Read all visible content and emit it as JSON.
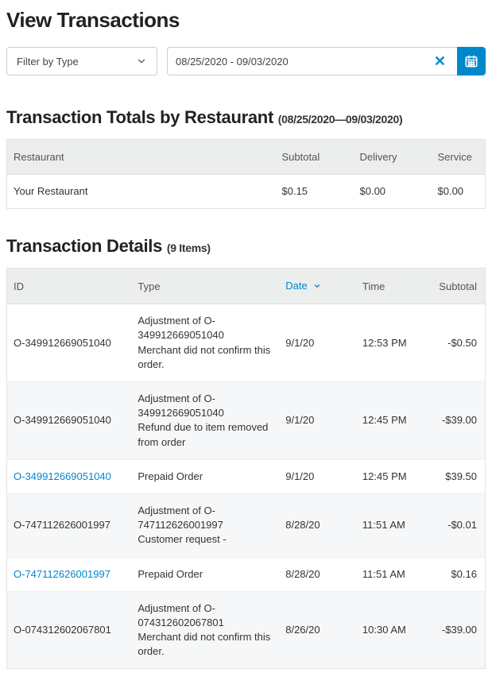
{
  "page_title": "View Transactions",
  "filter_type_label": "Filter by Type",
  "date_range_value": "08/25/2020 - 09/03/2020",
  "totals": {
    "heading": "Transaction Totals by Restaurant",
    "range": "(08/25/2020—09/03/2020)",
    "columns": {
      "restaurant": "Restaurant",
      "subtotal": "Subtotal",
      "delivery": "Delivery",
      "service": "Service"
    },
    "rows": [
      {
        "restaurant": "Your Restaurant",
        "subtotal": "$0.15",
        "delivery": "$0.00",
        "service": "$0.00"
      }
    ]
  },
  "details": {
    "heading": "Transaction Details",
    "count_label": "(9 Items)",
    "columns": {
      "id": "ID",
      "type": "Type",
      "date": "Date",
      "time": "Time",
      "subtotal": "Subtotal"
    },
    "rows": [
      {
        "id": "O-349912669051040",
        "link": false,
        "type": "Adjustment of O-349912669051040\nMerchant did not confirm this order.",
        "date": "9/1/20",
        "time": "12:53 PM",
        "subtotal": "-$0.50"
      },
      {
        "id": "O-349912669051040",
        "link": false,
        "type": "Adjustment of O-349912669051040\nRefund due to item removed from order",
        "date": "9/1/20",
        "time": "12:45 PM",
        "subtotal": "-$39.00"
      },
      {
        "id": "O-349912669051040",
        "link": true,
        "type": "Prepaid Order",
        "date": "9/1/20",
        "time": "12:45 PM",
        "subtotal": "$39.50"
      },
      {
        "id": "O-747112626001997",
        "link": false,
        "type": "Adjustment of O-747112626001997\nCustomer request -",
        "date": "8/28/20",
        "time": "11:51 AM",
        "subtotal": "-$0.01"
      },
      {
        "id": "O-747112626001997",
        "link": true,
        "type": "Prepaid Order",
        "date": "8/28/20",
        "time": "11:51 AM",
        "subtotal": "$0.16"
      },
      {
        "id": "O-074312602067801",
        "link": false,
        "type": "Adjustment of O-074312602067801\nMerchant did not confirm this order.",
        "date": "8/26/20",
        "time": "10:30 AM",
        "subtotal": "-$39.00"
      }
    ]
  }
}
